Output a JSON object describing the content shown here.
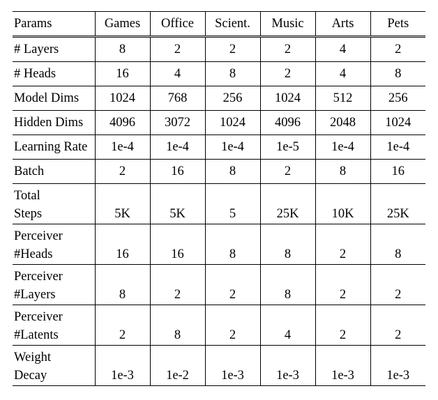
{
  "chart_data": {
    "type": "table",
    "title": "",
    "columns": [
      "Params",
      "Games",
      "Office",
      "Scient.",
      "Music",
      "Arts",
      "Pets"
    ],
    "rows": [
      {
        "label_lines": [
          "# Layers"
        ],
        "values": [
          "8",
          "2",
          "2",
          "2",
          "4",
          "2"
        ]
      },
      {
        "label_lines": [
          "# Heads"
        ],
        "values": [
          "16",
          "4",
          "8",
          "2",
          "4",
          "8"
        ]
      },
      {
        "label_lines": [
          "Model Dims"
        ],
        "values": [
          "1024",
          "768",
          "256",
          "1024",
          "512",
          "256"
        ]
      },
      {
        "label_lines": [
          "Hidden Dims"
        ],
        "values": [
          "4096",
          "3072",
          "1024",
          "4096",
          "2048",
          "1024"
        ]
      },
      {
        "label_lines": [
          "Learning Rate"
        ],
        "values": [
          "1e-4",
          "1e-4",
          "1e-4",
          "1e-5",
          "1e-4",
          "1e-4"
        ]
      },
      {
        "label_lines": [
          "Batch"
        ],
        "values": [
          "2",
          "16",
          "8",
          "2",
          "8",
          "16"
        ]
      },
      {
        "label_lines": [
          "Total",
          "Steps"
        ],
        "values": [
          "5K",
          "5K",
          "5",
          "25K",
          "10K",
          "25K"
        ]
      },
      {
        "label_lines": [
          "Perceiver",
          "#Heads"
        ],
        "values": [
          "16",
          "16",
          "8",
          "8",
          "2",
          "8"
        ]
      },
      {
        "label_lines": [
          "Perceiver",
          "#Layers"
        ],
        "values": [
          "8",
          "2",
          "2",
          "8",
          "2",
          "2"
        ]
      },
      {
        "label_lines": [
          "Perceiver",
          "#Latents"
        ],
        "values": [
          "2",
          "8",
          "2",
          "4",
          "2",
          "2"
        ]
      },
      {
        "label_lines": [
          "Weight",
          "Decay"
        ],
        "values": [
          "1e-3",
          "1e-2",
          "1e-3",
          "1e-3",
          "1e-3",
          "1e-3"
        ]
      }
    ]
  }
}
